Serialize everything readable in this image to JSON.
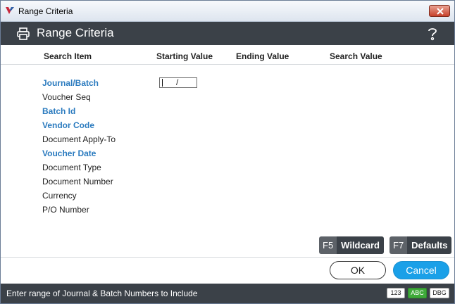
{
  "window": {
    "title": "Range Criteria"
  },
  "header": {
    "title": "Range Criteria",
    "print_icon": "printer-icon",
    "help_icon": "help-question-icon"
  },
  "columns": [
    "Search Item",
    "Starting Value",
    "Ending Value",
    "Search Value"
  ],
  "items": [
    {
      "label": "Journal/Batch",
      "required": true
    },
    {
      "label": "Voucher Seq",
      "required": false
    },
    {
      "label": "Batch Id",
      "required": true
    },
    {
      "label": "Vendor Code",
      "required": true
    },
    {
      "label": "Document Apply-To",
      "required": false
    },
    {
      "label": "Voucher Date",
      "required": true
    },
    {
      "label": "Document Type",
      "required": false
    },
    {
      "label": "Document Number",
      "required": false
    },
    {
      "label": "Currency",
      "required": false
    },
    {
      "label": "P/O Number",
      "required": false
    }
  ],
  "starting_input": {
    "value": "/"
  },
  "function_keys": [
    {
      "key": "F5",
      "label": "Wildcard"
    },
    {
      "key": "F7",
      "label": "Defaults"
    }
  ],
  "buttons": {
    "ok": "OK",
    "cancel": "Cancel"
  },
  "status": {
    "text": "Enter range of Journal & Batch Numbers to Include",
    "badges": [
      "123",
      "ABC",
      "DBG"
    ]
  },
  "colors": {
    "header_bg": "#3b4148",
    "required_label": "#2b7bbf",
    "cancel_bg": "#1aa0e8",
    "abc_badge": "#3faa3a"
  }
}
